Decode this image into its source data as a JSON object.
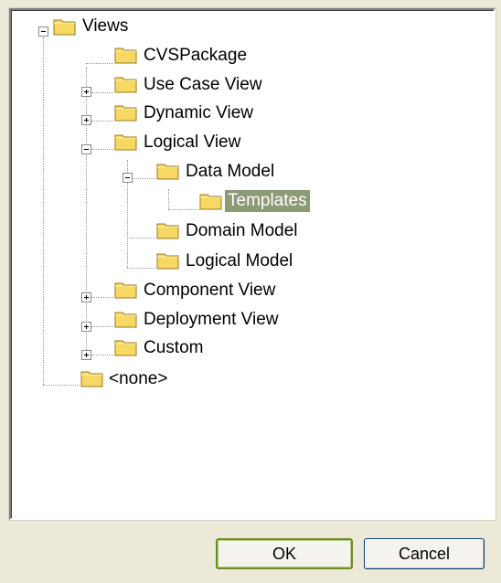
{
  "tree": {
    "nodes": [
      {
        "label": "Views",
        "expander": "minus"
      },
      {
        "label": "CVSPackage",
        "expander": ""
      },
      {
        "label": "Use Case View",
        "expander": "plus"
      },
      {
        "label": "Dynamic View",
        "expander": "plus"
      },
      {
        "label": "Logical View",
        "expander": "minus"
      },
      {
        "label": "Data Model",
        "expander": "minus"
      },
      {
        "label": "Templates",
        "expander": "",
        "selected": true
      },
      {
        "label": "Domain Model",
        "expander": ""
      },
      {
        "label": "Logical Model",
        "expander": ""
      },
      {
        "label": "Component View",
        "expander": "plus"
      },
      {
        "label": "Deployment View",
        "expander": "plus"
      },
      {
        "label": "Custom",
        "expander": "plus"
      },
      {
        "label": "<none>",
        "expander": ""
      }
    ]
  },
  "buttons": {
    "ok_label": "OK",
    "cancel_label": "Cancel"
  },
  "colors": {
    "selection_bg": "#8c9a75",
    "folder_fill": "#f6d863",
    "dialog_bg": "#ece9d8"
  },
  "icons": {
    "folder": "folder-icon",
    "expand": "expand-plus-icon",
    "collapse": "collapse-minus-icon"
  }
}
